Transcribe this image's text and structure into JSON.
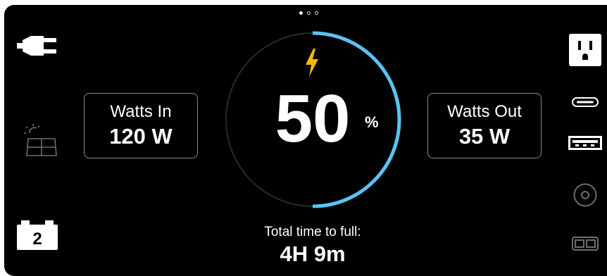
{
  "pager": {
    "pages": 3,
    "active_index": 0
  },
  "inputs": {
    "ac_plug_icon": "plug-icon",
    "solar_icon": "solar-panel-icon",
    "car_battery_icon": "car-battery-icon",
    "car_battery_number": "2"
  },
  "watts_in": {
    "label": "Watts In",
    "value": "120 W"
  },
  "watts_out": {
    "label": "Watts Out",
    "value": "35 W"
  },
  "battery": {
    "percent": 50,
    "value": "50",
    "unit": "%",
    "charging_icon": "lightning-bolt-icon"
  },
  "time_to_full": {
    "label": "Total time to full:",
    "value": "4H 9m"
  },
  "outputs": {
    "ac_outlet_icon": "ac-outlet-icon",
    "usb_c_icon": "usb-c-icon",
    "usb_a_icon": "usb-a-icon",
    "dc_port_icon": "dc-barrel-port-icon",
    "anderson_port_icon": "anderson-port-icon"
  },
  "colors": {
    "background": "#000000",
    "ring_progress": "#5bc3f0",
    "ring_track": "#2a2a2a",
    "charging_bolt": "#f5b800",
    "text": "#ffffff",
    "inactive_icon": "#6e6e6e"
  }
}
